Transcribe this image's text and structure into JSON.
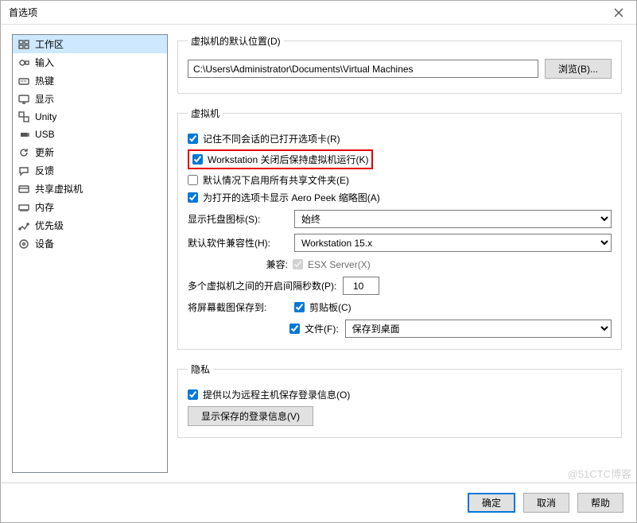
{
  "titlebar": {
    "title": "首选项"
  },
  "sidebar": {
    "items": [
      {
        "label": "工作区",
        "icon": "workspace-icon",
        "selected": true
      },
      {
        "label": "输入",
        "icon": "input-icon"
      },
      {
        "label": "热键",
        "icon": "hotkeys-icon"
      },
      {
        "label": "显示",
        "icon": "display-icon"
      },
      {
        "label": "Unity",
        "icon": "unity-icon"
      },
      {
        "label": "USB",
        "icon": "usb-icon"
      },
      {
        "label": "更新",
        "icon": "updates-icon"
      },
      {
        "label": "反馈",
        "icon": "feedback-icon"
      },
      {
        "label": "共享虚拟机",
        "icon": "shared-vm-icon"
      },
      {
        "label": "内存",
        "icon": "memory-icon"
      },
      {
        "label": "优先级",
        "icon": "priority-icon"
      },
      {
        "label": "设备",
        "icon": "devices-icon"
      }
    ]
  },
  "default_location": {
    "legend": "虚拟机的默认位置(D)",
    "path": "C:\\Users\\Administrator\\Documents\\Virtual Machines",
    "browse": "浏览(B)..."
  },
  "vm": {
    "legend": "虚拟机",
    "chk_remember_tabs": "记住不同会话的已打开选项卡(R)",
    "chk_keep_running": "Workstation 关闭后保持虚拟机运行(K)",
    "chk_shared_folders": "默认情况下启用所有共享文件夹(E)",
    "chk_aero_peek": "为打开的选项卡显示 Aero Peek 缩略图(A)",
    "tray_label": "显示托盘图标(S):",
    "tray_value": "始终",
    "compat_label": "默认软件兼容性(H):",
    "compat_value": "Workstation 15.x",
    "compat_sub_label": "兼容:",
    "compat_sub_value": "ESX Server(X)",
    "interval_label": "多个虚拟机之间的开启间隔秒数(P):",
    "interval_value": "10",
    "screenshot_label": "将屏幕截图保存到:",
    "chk_clipboard": "剪贴板(C)",
    "chk_file": "文件(F):",
    "file_dest_value": "保存到桌面"
  },
  "privacy": {
    "legend": "隐私",
    "chk_offer_save": "提供以为远程主机保存登录信息(O)",
    "show_saved": "显示保存的登录信息(V)"
  },
  "footer": {
    "ok": "确定",
    "cancel": "取消",
    "help": "帮助"
  },
  "watermark": "@51CTC博客"
}
